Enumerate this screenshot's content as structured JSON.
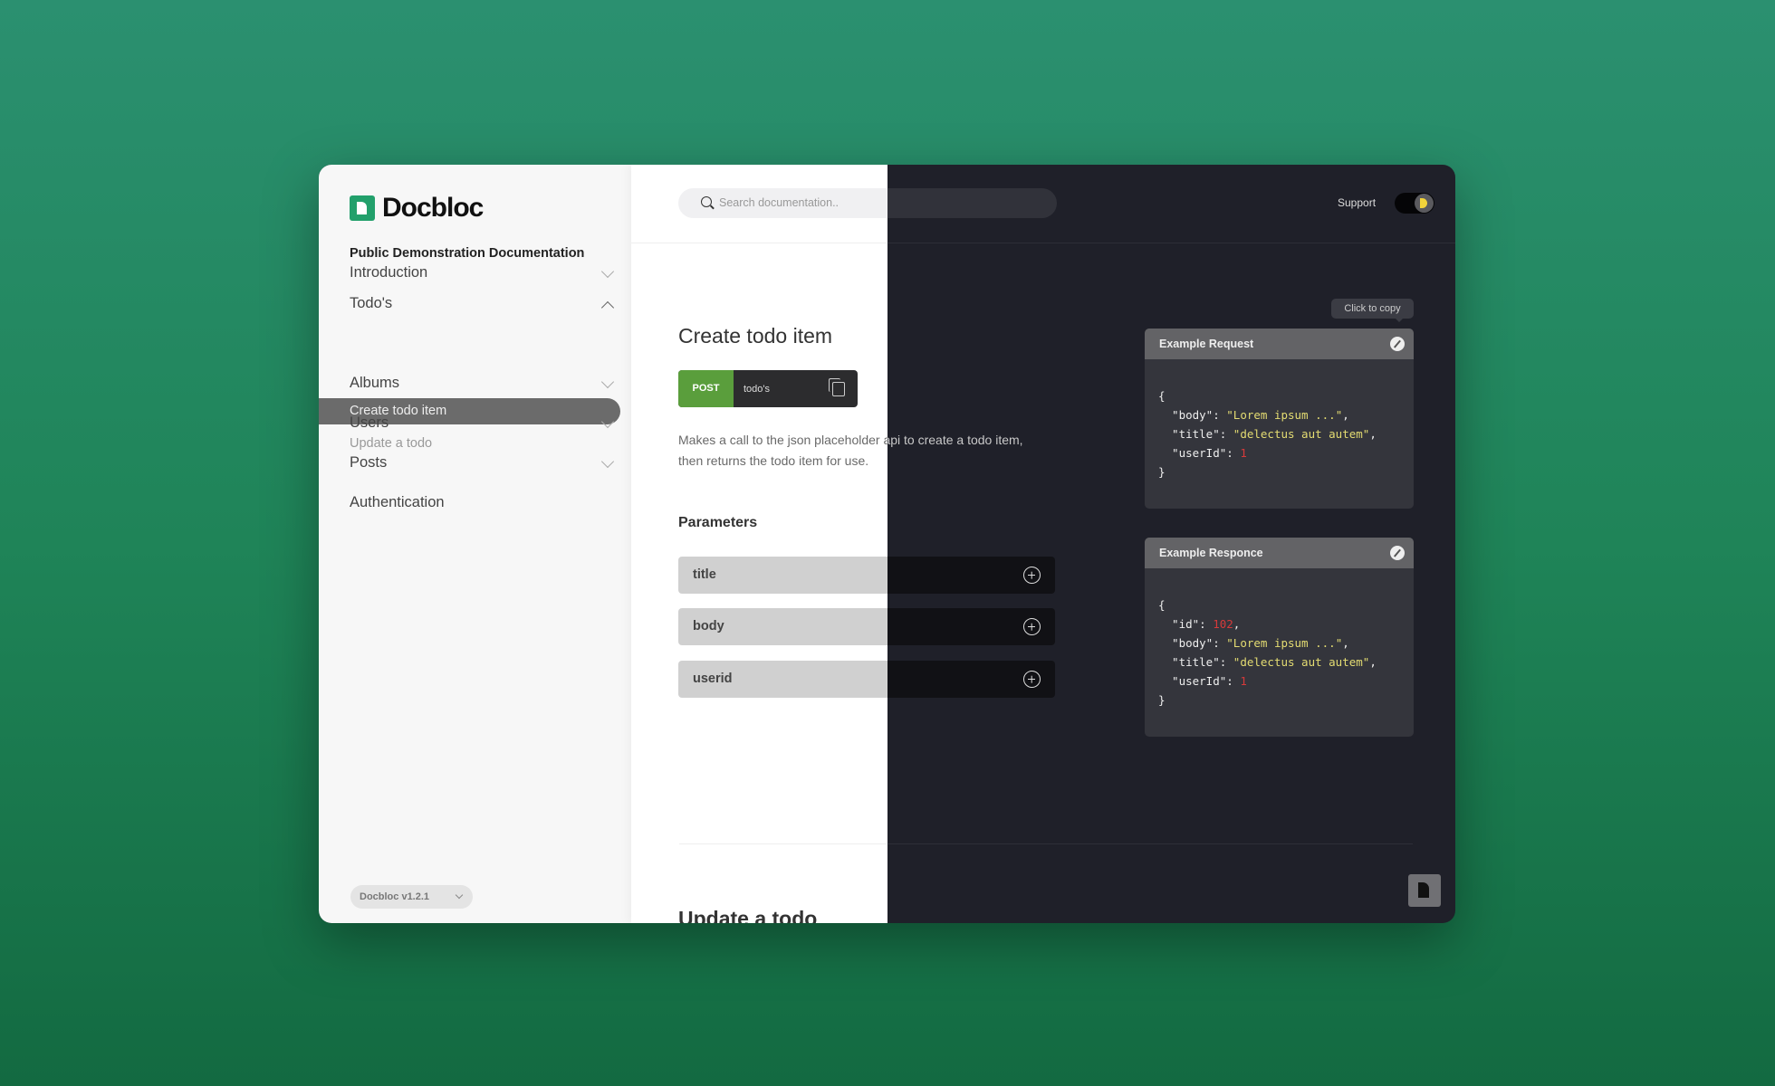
{
  "app": {
    "name": "Docbloc",
    "subtitle": "Public Demonstration Documentation",
    "version": "Docbloc v1.2.1"
  },
  "sidebar": {
    "items": [
      {
        "label": "Introduction",
        "expanded": false
      },
      {
        "label": "Todo's",
        "expanded": true,
        "children": [
          {
            "label": "Create todo item",
            "active": true
          },
          {
            "label": "Update a todo",
            "active": false
          }
        ]
      },
      {
        "label": "Albums",
        "expanded": false
      },
      {
        "label": "Users",
        "expanded": false
      },
      {
        "label": "Posts",
        "expanded": false
      },
      {
        "label": "Authentication"
      }
    ]
  },
  "header": {
    "search_placeholder": "Search documentation..",
    "support": "Support",
    "dark_mode": true
  },
  "section": {
    "title": "Create todo item",
    "method": "POST",
    "route": "todo's",
    "description": "Makes a call to the json placeholder api to create a todo item, then returns the todo item for use.",
    "parameters_label": "Parameters",
    "parameters": [
      "title",
      "body",
      "userid"
    ]
  },
  "tooltip": "Click to copy",
  "request": {
    "title": "Example Request",
    "body": "Lorem ipsum ...",
    "ttl": "delectus aut autem",
    "userId": "1"
  },
  "response": {
    "title": "Example Responce",
    "id": "102",
    "body": "Lorem ipsum ...",
    "ttl": "delectus aut autem",
    "userId": "1"
  },
  "next_section": {
    "title": "Update a todo"
  },
  "colors": {
    "brand": "#22a06b",
    "post": "#5a9e3c",
    "string": "#e4dc72",
    "number": "#d63a3a"
  }
}
